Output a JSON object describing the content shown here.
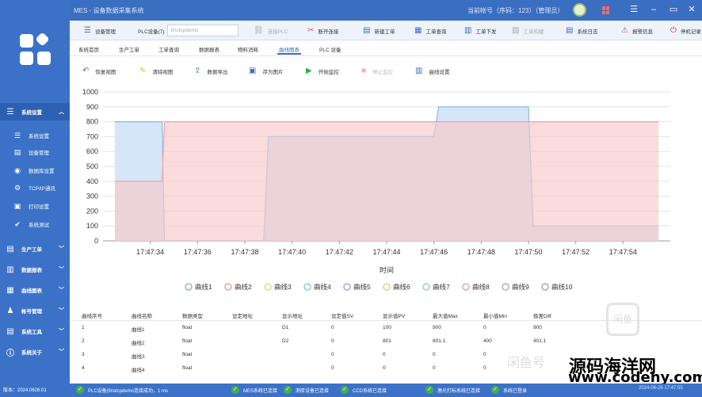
{
  "window": {
    "title": "MES - 设备数据采集系统",
    "user": "当前帐号（序码：123）（管理员）"
  },
  "sidebar": {
    "items": [
      {
        "label": "系统设置",
        "icon": "menu-icon",
        "group": true
      },
      {
        "label": "系统设置",
        "icon": "list-icon"
      },
      {
        "label": "设备管理",
        "icon": "device-icon"
      },
      {
        "label": "数据库设置",
        "icon": "database-icon"
      },
      {
        "label": "TCP/IP通讯",
        "icon": "network-icon"
      },
      {
        "label": "打印设置",
        "icon": "print-icon"
      },
      {
        "label": "系统测试",
        "icon": "shield-check-icon"
      },
      {
        "label": "生产工单",
        "icon": "order-icon",
        "group": true
      },
      {
        "label": "数据报表",
        "icon": "report-icon",
        "group": true
      },
      {
        "label": "曲线图表",
        "icon": "chart-icon",
        "group": true
      },
      {
        "label": "帐号管理",
        "icon": "users-icon",
        "group": true
      },
      {
        "label": "系统工具",
        "icon": "tools-icon",
        "group": true
      },
      {
        "label": "系统关于",
        "icon": "info-icon",
        "group": true
      }
    ]
  },
  "toolbar": {
    "device_mgmt": "设备管理",
    "plc_device": "PLC设备(7)",
    "plc_combo": "finstcpdemo",
    "connect_plc": "连接PLC",
    "disconnect": "断开连接",
    "new_order": "新建工单",
    "query_order": "工单查询",
    "issue_order": "工单下发",
    "order_mgmt": "工单构建",
    "system_log": "系统日志",
    "alarm_info": "报警信息",
    "stop": "停机记录"
  },
  "tabs": [
    "系统首页",
    "生产工单",
    "工单查询",
    "数据报表",
    "物料消耗",
    "曲线图表",
    "PLC 设备"
  ],
  "active_tab": 5,
  "actions": {
    "restore_view": "恢复视图",
    "clear_view": "清除视图",
    "export_data": "数据导出",
    "save_image": "存为图片",
    "start_monitor": "开始监控",
    "stop_monitor": "停止监控",
    "curve_settings": "曲线设置"
  },
  "chart_data": {
    "type": "area",
    "xlabel": "时间",
    "ylim": [
      0,
      1000
    ],
    "yticks": [
      0,
      100,
      200,
      300,
      400,
      500,
      600,
      700,
      800,
      900,
      1000
    ],
    "xticks": [
      "17:47:34",
      "17:47:36",
      "17:47:38",
      "17:47:40",
      "17:47:42",
      "17:47:44",
      "17:47:46",
      "17:47:48",
      "17:47:50",
      "17:47:52",
      "17:47:54"
    ],
    "xlim": [
      0,
      24
    ],
    "grid": "horizontal",
    "legend_position": "bottom",
    "series": [
      {
        "name": "曲线1",
        "color": "#8ab8e6",
        "fill": "#cfe3f6",
        "points": [
          [
            0.5,
            800
          ],
          [
            2.5,
            800
          ],
          [
            2.6,
            0
          ],
          [
            6.8,
            0
          ],
          [
            7.0,
            700
          ],
          [
            14.0,
            700
          ],
          [
            14.2,
            900
          ],
          [
            18.0,
            900
          ],
          [
            18.2,
            100
          ],
          [
            23.5,
            100
          ]
        ]
      },
      {
        "name": "曲线2",
        "color": "#f2a0a0",
        "fill": "#f8c9c9",
        "points": [
          [
            0.5,
            400
          ],
          [
            2.5,
            400
          ],
          [
            2.6,
            800
          ],
          [
            23.5,
            800
          ]
        ]
      }
    ],
    "legend": [
      {
        "name": "曲线1",
        "color": "#8ab8e6"
      },
      {
        "name": "曲线2",
        "color": "#f2a0a0"
      },
      {
        "name": "曲线3",
        "color": "#e8d98a"
      },
      {
        "name": "曲线4",
        "color": "#7fd1d8"
      },
      {
        "name": "曲线5",
        "color": "#a6a6e6"
      },
      {
        "name": "曲线6",
        "color": "#e0d08a"
      },
      {
        "name": "曲线7",
        "color": "#8fd6c8"
      },
      {
        "name": "曲线8",
        "color": "#f2a0b0"
      },
      {
        "name": "曲线9",
        "color": "#b0b0b0"
      },
      {
        "name": "曲线10",
        "color": "#a0a8c8"
      }
    ]
  },
  "table": {
    "headers": [
      "曲线序号",
      "曲线名称",
      "数据类型",
      "设定地址",
      "显示地址",
      "设定值SV",
      "显示值PV",
      "最大值Max",
      "最小值Min",
      "极差Diff"
    ],
    "rows": [
      [
        "1",
        "曲线1",
        "float",
        "",
        "D1",
        "0",
        "100",
        "900",
        "0",
        "900"
      ],
      [
        "2",
        "曲线2",
        "float",
        "",
        "D2",
        "0",
        "801",
        "801.1",
        "400",
        "401.1"
      ],
      [
        "3",
        "曲线3",
        "float",
        "",
        "",
        "0",
        "0",
        "0",
        "0",
        ""
      ],
      [
        "4",
        "曲线4",
        "float",
        "",
        "",
        "0",
        "0",
        "0",
        "0",
        ""
      ]
    ]
  },
  "watermark": {
    "seal": "闲鱼",
    "xianyu": "闲鱼号",
    "site_name": "源码海洋网",
    "site_url": "www.codehy.com"
  },
  "status": {
    "version": "版本：2024.0626.01",
    "items": [
      "PLC设备(finstcpdemo连接成功，1 ms",
      "MES系统已连接",
      "测厚设备已连接",
      "CCD系统已连接",
      "激光打标系统已连接",
      "系统已登录"
    ],
    "time": "2024-06-26 17:47:55"
  }
}
